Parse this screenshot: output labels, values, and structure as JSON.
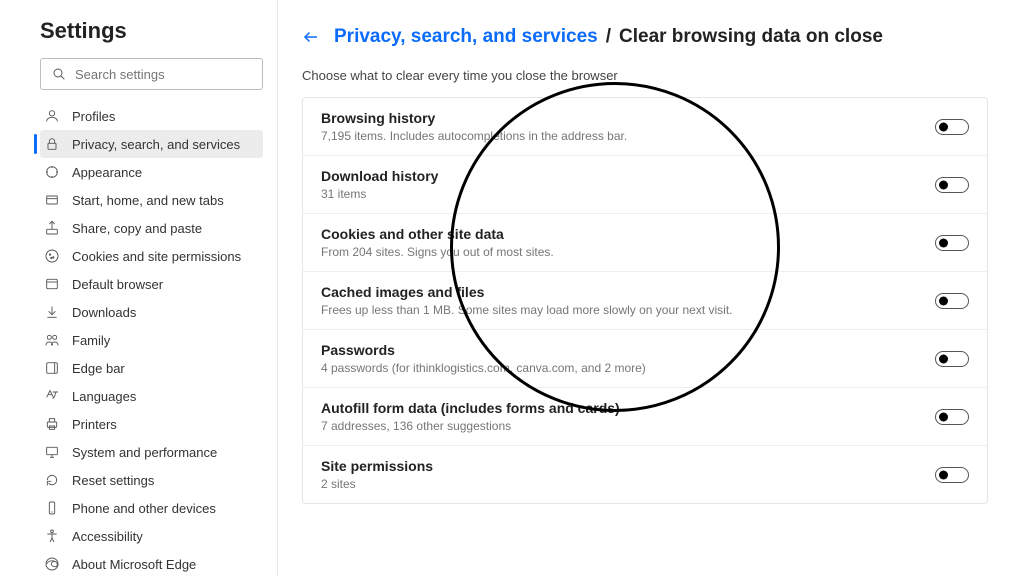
{
  "sidebar": {
    "title": "Settings",
    "search_placeholder": "Search settings",
    "items": [
      {
        "label": "Profiles"
      },
      {
        "label": "Privacy, search, and services"
      },
      {
        "label": "Appearance"
      },
      {
        "label": "Start, home, and new tabs"
      },
      {
        "label": "Share, copy and paste"
      },
      {
        "label": "Cookies and site permissions"
      },
      {
        "label": "Default browser"
      },
      {
        "label": "Downloads"
      },
      {
        "label": "Family"
      },
      {
        "label": "Edge bar"
      },
      {
        "label": "Languages"
      },
      {
        "label": "Printers"
      },
      {
        "label": "System and performance"
      },
      {
        "label": "Reset settings"
      },
      {
        "label": "Phone and other devices"
      },
      {
        "label": "Accessibility"
      },
      {
        "label": "About Microsoft Edge"
      }
    ]
  },
  "breadcrumb": {
    "parent": "Privacy, search, and services",
    "sep": "/",
    "current": "Clear browsing data on close"
  },
  "description": "Choose what to clear every time you close the browser",
  "options": [
    {
      "title": "Browsing history",
      "sub": "7,195 items. Includes autocompletions in the address bar.",
      "on": false
    },
    {
      "title": "Download history",
      "sub": "31 items",
      "on": false
    },
    {
      "title": "Cookies and other site data",
      "sub": "From 204 sites. Signs you out of most sites.",
      "on": false
    },
    {
      "title": "Cached images and files",
      "sub": "Frees up less than 1 MB. Some sites may load more slowly on your next visit.",
      "on": false
    },
    {
      "title": "Passwords",
      "sub": "4 passwords (for ithinklogistics.com, canva.com, and 2 more)",
      "on": false
    },
    {
      "title": "Autofill form data (includes forms and cards)",
      "sub": "7 addresses, 136 other suggestions",
      "on": false
    },
    {
      "title": "Site permissions",
      "sub": "2 sites",
      "on": false
    }
  ]
}
